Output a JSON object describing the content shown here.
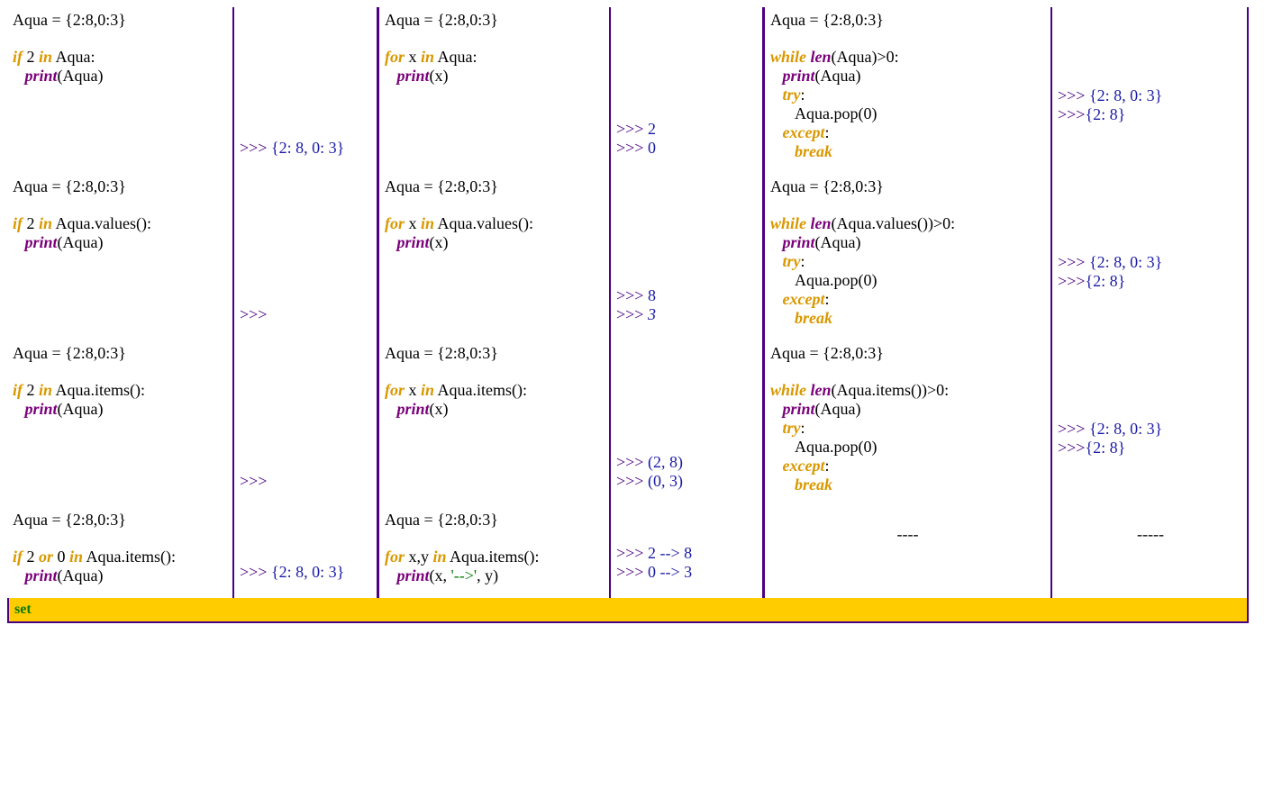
{
  "assign": "Aqua = {2:8,0:3}",
  "kw": {
    "if": "if",
    "in": "in",
    "for": "for",
    "while": "while",
    "len": "len",
    "try": "try",
    "except": "except",
    "break": "break",
    "or": "or",
    "print": "print"
  },
  "c1": {
    "r1": {
      "l2a": " 2 ",
      "l2b": " Aqua:",
      "l3": "(Aqua)"
    },
    "r2": {
      "l2a": " 2 ",
      "l2b": " Aqua.values():",
      "l3": "(Aqua)"
    },
    "r3": {
      "l2a": " 2 ",
      "l2b": " Aqua.items():",
      "l3": "(Aqua)"
    },
    "r4": {
      "l2a": " 2 ",
      "l2b": " 0 ",
      "l2c": " Aqua.items():",
      "l3": "(Aqua)"
    }
  },
  "c2": {
    "r1": ">>> {2: 8, 0: 3}",
    "r2": ">>>",
    "r3": ">>>",
    "r4": ">>> {2: 8, 0: 3}"
  },
  "c3": {
    "r1": {
      "l2a": " x ",
      "l2b": " Aqua:",
      "l3": "(x)"
    },
    "r2": {
      "l2a": " x ",
      "l2b": " Aqua.values():",
      "l3": "(x)"
    },
    "r3": {
      "l2a": " x ",
      "l2b": " Aqua.items():",
      "l3": "(x)"
    },
    "r4": {
      "l2a": " x,y ",
      "l2b": " Aqua.items():",
      "l3a": "(x, ",
      "l3s": "'-->'",
      "l3b": ", y)"
    }
  },
  "c4": {
    "r1": {
      "a": ">>> 2",
      "b": ">>> 0"
    },
    "r2": {
      "a": ">>> 8",
      "b": ">>> 3"
    },
    "r3": {
      "a": ">>> (2, 8)",
      "b": ">>> (0, 3)"
    },
    "r4": {
      "a": ">>> 2 --> 8",
      "b": ">>> 0 --> 3"
    }
  },
  "c5": {
    "r1": {
      "cond": "(Aqua)>0:",
      "body": "(Aqua)",
      "pop": "Aqua.pop(0)"
    },
    "r2": {
      "cond": "(Aqua.values())>0:",
      "body": "(Aqua)",
      "pop": "Aqua.pop(0)"
    },
    "r3": {
      "cond": "(Aqua.items())>0:",
      "body": "(Aqua)",
      "pop": "Aqua.pop(0)"
    },
    "r4": "----"
  },
  "c6": {
    "r1": {
      "a": ">>> {2: 8, 0: 3}",
      "b": ">>>{2: 8}"
    },
    "r2": {
      "a": ">>> {2: 8, 0: 3}",
      "b": ">>>{2: 8}"
    },
    "r3": {
      "a": ">>> {2: 8, 0: 3}",
      "b": ">>>{2: 8}"
    },
    "r4": "-----"
  },
  "footer": "set"
}
